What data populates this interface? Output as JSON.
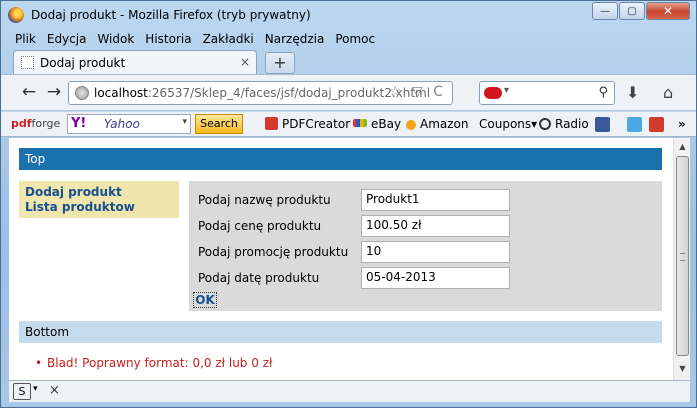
{
  "window": {
    "title": "Dodaj produkt - Mozilla Firefox (tryb prywatny)",
    "controls": {
      "minimize": "—",
      "maximize": "▢",
      "close": "✕"
    }
  },
  "menu": [
    {
      "label": "Plik"
    },
    {
      "label": "Edycja"
    },
    {
      "label": "Widok"
    },
    {
      "label": "Historia"
    },
    {
      "label": "Zakładki"
    },
    {
      "label": "Narzędzia"
    },
    {
      "label": "Pomoc"
    }
  ],
  "tab": {
    "title": "Dodaj produkt",
    "close": "×",
    "new_tab": "+"
  },
  "nav": {
    "back": "←",
    "forward": "→",
    "url_host": "localhost",
    "url_rest": ":26537/Sklep_4/faces/jsf/dodaj_produkt2.xhtml",
    "url_icons": "☆ ▽ C",
    "search_dropdown": "▾",
    "search_icon": "⚲",
    "download_icon": "⬇",
    "home_icon": "⌂"
  },
  "addon": {
    "pdfforge_prefix": "pdf",
    "pdfforge_suffix": "forge",
    "yahoo_logo": "Y!",
    "yahoo_placeholder": "Yahoo",
    "yahoo_dropdown": "▾",
    "search_button": "Search",
    "bookmarks": {
      "pdfcreator": "PDFCreator",
      "ebay": "eBay",
      "amazon": "Amazon",
      "coupons": "Coupons▾",
      "radio": "Radio",
      "more": "»"
    }
  },
  "page": {
    "top_label": "Top",
    "left_menu": [
      {
        "label": "Dodaj produkt"
      },
      {
        "label": "Lista produktow"
      }
    ],
    "form": {
      "fields": [
        {
          "label": "Podaj nazwę produktu",
          "value": "Produkt1"
        },
        {
          "label": "Podaj cenę produktu",
          "value": "100.50 zł"
        },
        {
          "label": "Podaj promocję produktu",
          "value": "10"
        },
        {
          "label": "Podaj datę produktu",
          "value": "05-04-2013"
        }
      ],
      "submit_label": "OK"
    },
    "bottom_label": "Bottom",
    "error_message": "Blad! Poprawny format: 0,0 zł lub 0 zł"
  },
  "statusbar": {
    "s_label": "S",
    "dropdown": "▾",
    "close": "×"
  },
  "colors": {
    "top_bar": "#1b70ae",
    "left_menu": "#efe5ad",
    "form_panel": "#dadada",
    "bottom_bar": "#c5dcee",
    "error": "#c8201e",
    "link": "#17508f"
  }
}
